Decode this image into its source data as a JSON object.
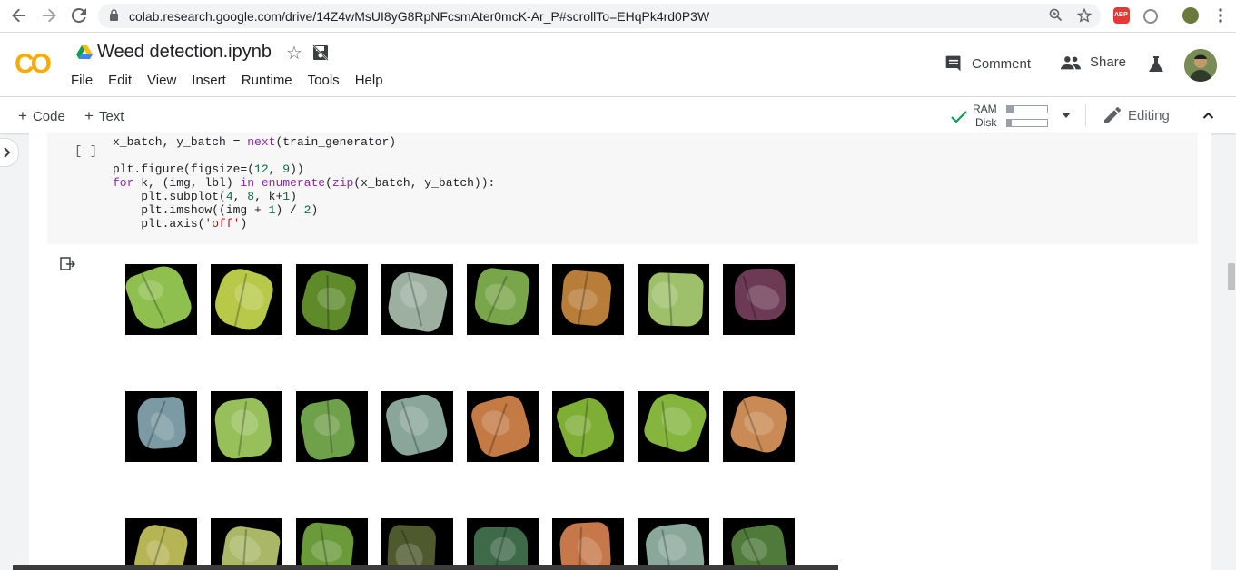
{
  "browser": {
    "url": "colab.research.google.com/drive/14Z4wMsUI8yG8RpNFcsmAter0mcK-Ar_P#scrollTo=EHqPk4rd0P3W",
    "abp_label": "ABP",
    "icons": [
      "back-icon",
      "forward-icon",
      "reload-icon",
      "lock-icon",
      "zoom-icon",
      "star-icon",
      "menu-dots-icon"
    ]
  },
  "header": {
    "logo_text": "CO",
    "notebook_title": "Weed detection.ipynb",
    "menu": [
      "File",
      "Edit",
      "View",
      "Insert",
      "Runtime",
      "Tools",
      "Help"
    ],
    "comment_label": "Comment",
    "share_label": "Share"
  },
  "toolbar": {
    "add_code": "Code",
    "add_text": "Text",
    "ram_label": "RAM",
    "disk_label": "Disk",
    "ram_usage": 0.15,
    "disk_usage": 0.12,
    "editing_label": "Editing"
  },
  "cell": {
    "run_label": "[ ]",
    "code_lines": [
      "x_batch, y_batch = next(train_generator)",
      "",
      "plt.figure(figsize=(12, 9))",
      "for k, (img, lbl) in enumerate(zip(x_batch, y_batch)):",
      "    plt.subplot(4, 8, k+1)",
      "    plt.imshow((img + 1) / 2)",
      "    plt.axis('off')"
    ]
  },
  "output": {
    "thumb_colors": [
      [
        "#8fbf4e",
        "#b8c94a",
        "#5e8a2a",
        "#9db0a0",
        "#79a64a",
        "#b97d3a",
        "#9fc06a",
        "#6d3a55"
      ],
      [
        "#7b9aa3",
        "#98c05a",
        "#6fa04a",
        "#8aa69a",
        "#c47a45",
        "#7fae35",
        "#86b53e",
        "#c98a55"
      ],
      [
        "#b6b556",
        "#a9b766",
        "#6a9a3a",
        "#4e5a2e",
        "#3f6a4a",
        "#c6784a",
        "#8aa89a",
        "#4f7a3a"
      ]
    ]
  }
}
